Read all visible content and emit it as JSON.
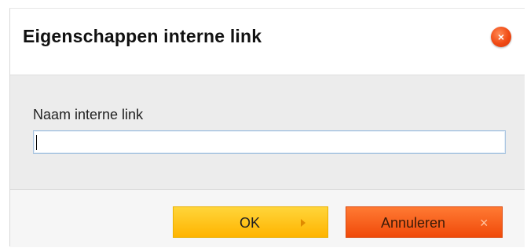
{
  "dialog": {
    "title": "Eigenschappen interne link",
    "close_icon": "close-icon",
    "close_glyph": "×"
  },
  "form": {
    "name_label": "Naam interne link",
    "name_value": "",
    "name_placeholder": ""
  },
  "footer": {
    "ok_label": "OK",
    "ok_icon": "arrow-right-icon",
    "cancel_label": "Annuleren",
    "cancel_icon": "close-icon",
    "cancel_glyph": "×"
  },
  "colors": {
    "ok_button": "#ffc41a",
    "cancel_button": "#f75a1a",
    "close_button": "#f04a14",
    "body_background": "#ececec"
  }
}
